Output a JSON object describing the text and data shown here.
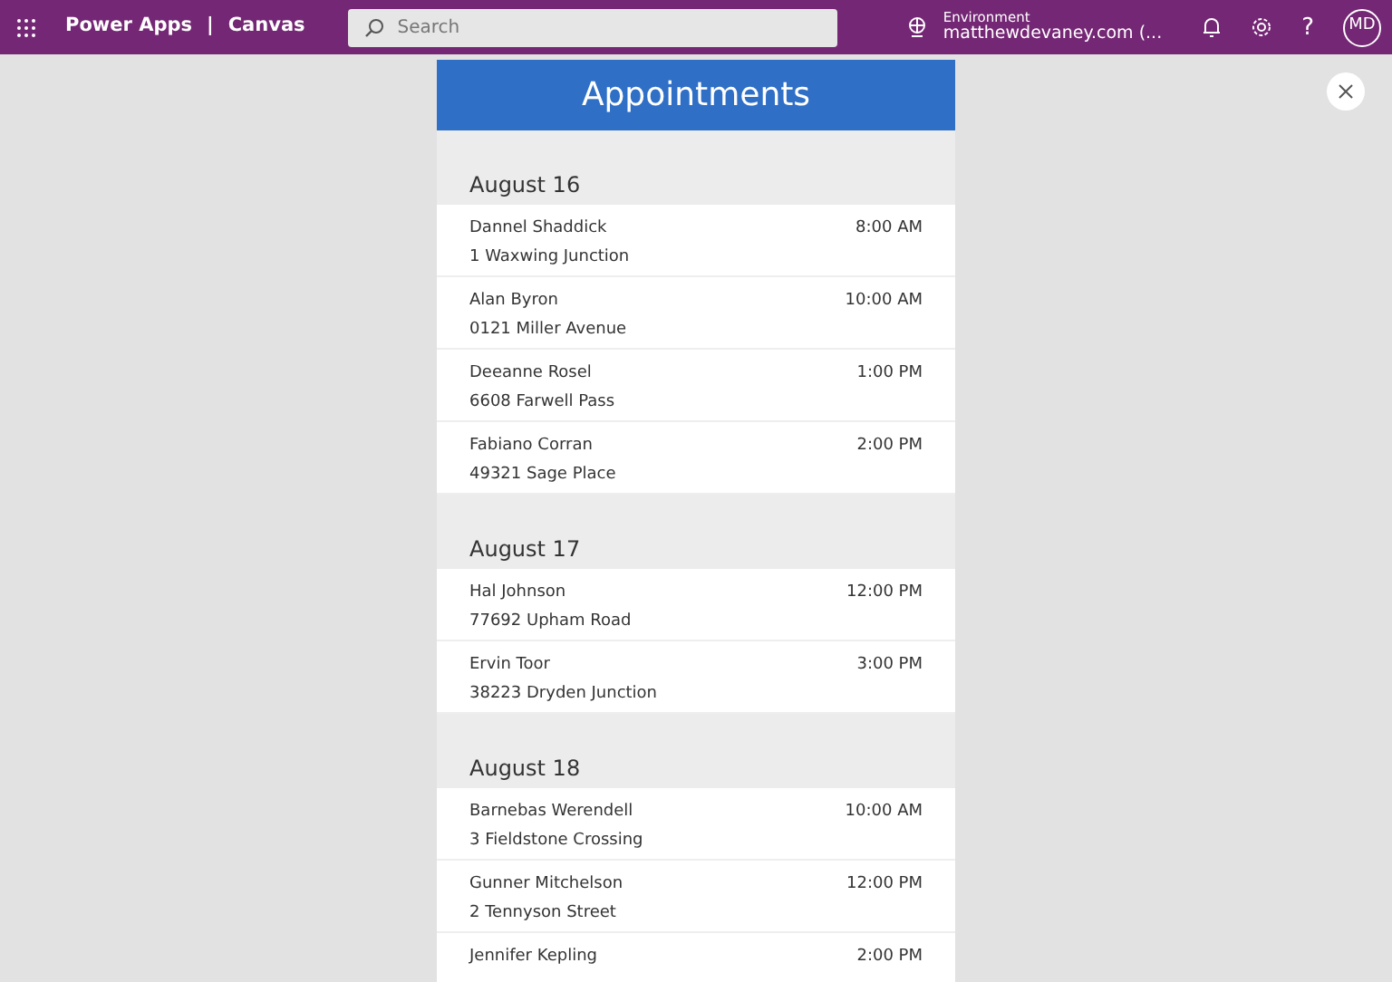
{
  "topbar": {
    "app_name": "Power Apps",
    "separator": "|",
    "section": "Canvas",
    "search": {
      "placeholder": "Search"
    },
    "environment_label": "Environment",
    "environment_value": "matthewdevaney.com (...",
    "avatar": "MD",
    "help": "?"
  },
  "app": {
    "title": "Appointments",
    "groups": [
      {
        "date": "August 16",
        "items": [
          {
            "name": "Dannel Shaddick",
            "time": "8:00 AM",
            "address": "1 Waxwing Junction"
          },
          {
            "name": "Alan Byron",
            "time": "10:00 AM",
            "address": "0121 Miller Avenue"
          },
          {
            "name": "Deeanne Rosel",
            "time": "1:00 PM",
            "address": "6608 Farwell Pass"
          },
          {
            "name": "Fabiano Corran",
            "time": "2:00 PM",
            "address": "49321 Sage Place"
          }
        ]
      },
      {
        "date": "August 17",
        "items": [
          {
            "name": "Hal Johnson",
            "time": "12:00 PM",
            "address": "77692 Upham Road"
          },
          {
            "name": "Ervin Toor",
            "time": "3:00 PM",
            "address": "38223 Dryden Junction"
          }
        ]
      },
      {
        "date": "August 18",
        "items": [
          {
            "name": "Barnebas Werendell",
            "time": "10:00 AM",
            "address": "3 Fieldstone Crossing"
          },
          {
            "name": "Gunner Mitchelson",
            "time": "12:00 PM",
            "address": "2 Tennyson Street"
          },
          {
            "name": "Jennifer Kepling",
            "time": "2:00 PM"
          }
        ]
      }
    ]
  }
}
